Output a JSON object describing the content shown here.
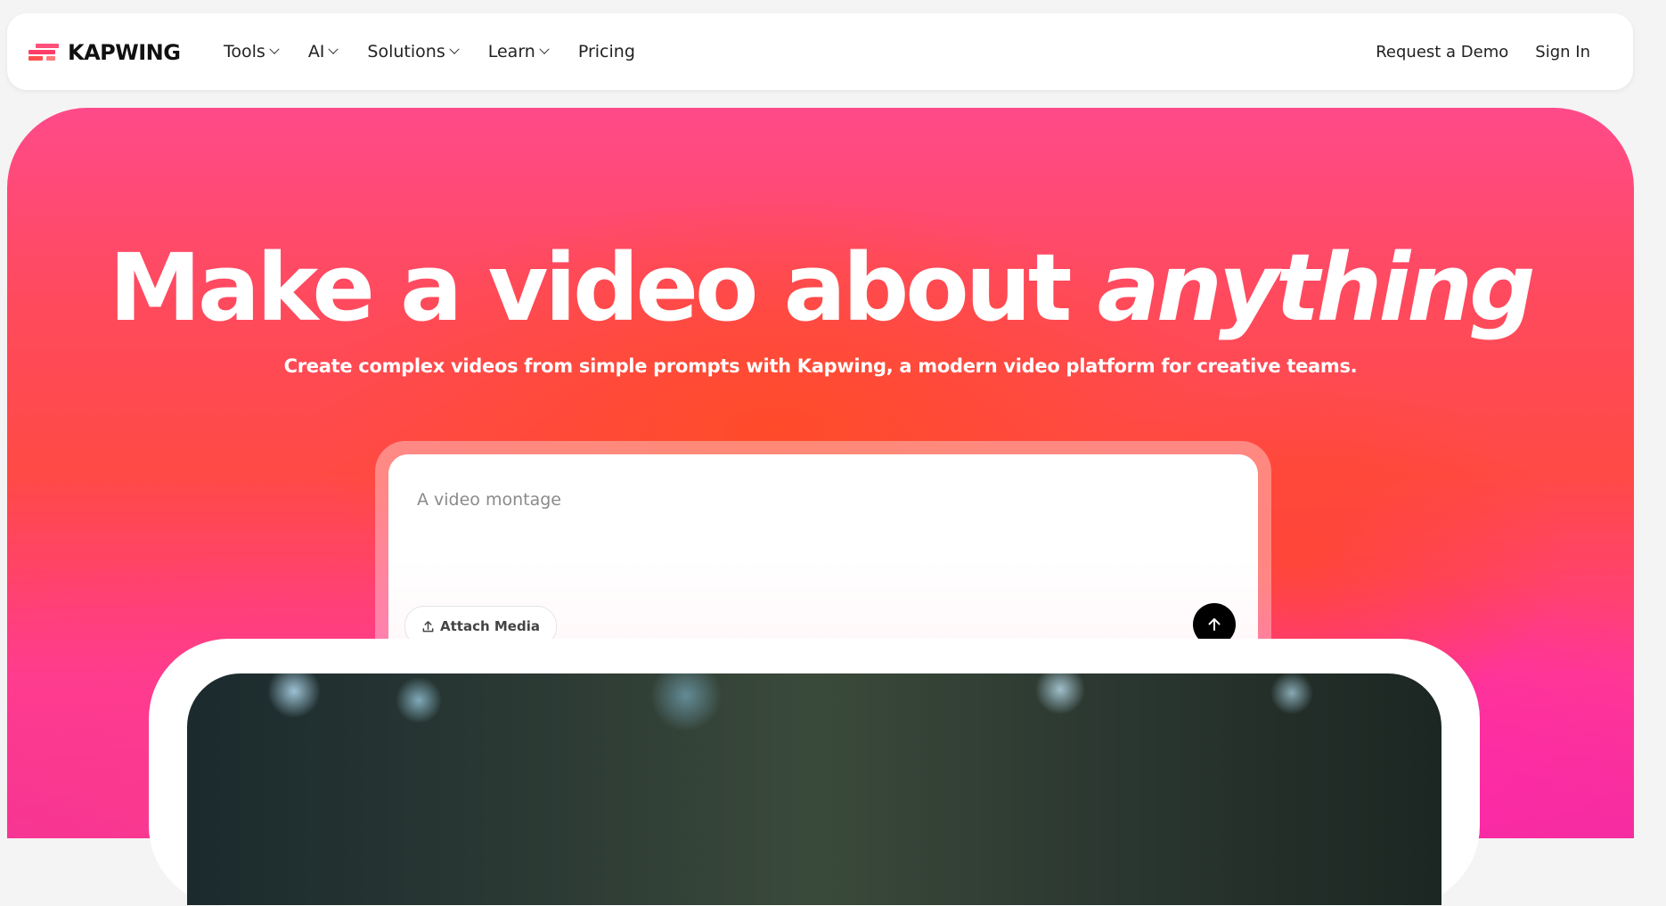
{
  "nav": {
    "logo_text": "KAPWING",
    "items": [
      {
        "label": "Tools",
        "has_dropdown": true
      },
      {
        "label": "AI",
        "has_dropdown": true
      },
      {
        "label": "Solutions",
        "has_dropdown": true
      },
      {
        "label": "Learn",
        "has_dropdown": true
      },
      {
        "label": "Pricing",
        "has_dropdown": false
      }
    ],
    "request_demo": "Request a Demo",
    "sign_in": "Sign In"
  },
  "hero": {
    "title_main": "Make a video about ",
    "title_emphasis": "anything",
    "subtitle": "Create complex videos from simple prompts with Kapwing, a modern video platform for creative teams."
  },
  "prompt": {
    "placeholder": "A video montage",
    "value": "",
    "attach_label": "Attach Media",
    "send_icon": "arrow-up-icon"
  },
  "colors": {
    "brand": "#ff4a5f",
    "hero_pink": "#ff3c8e",
    "hero_orange": "#ff4b28"
  }
}
